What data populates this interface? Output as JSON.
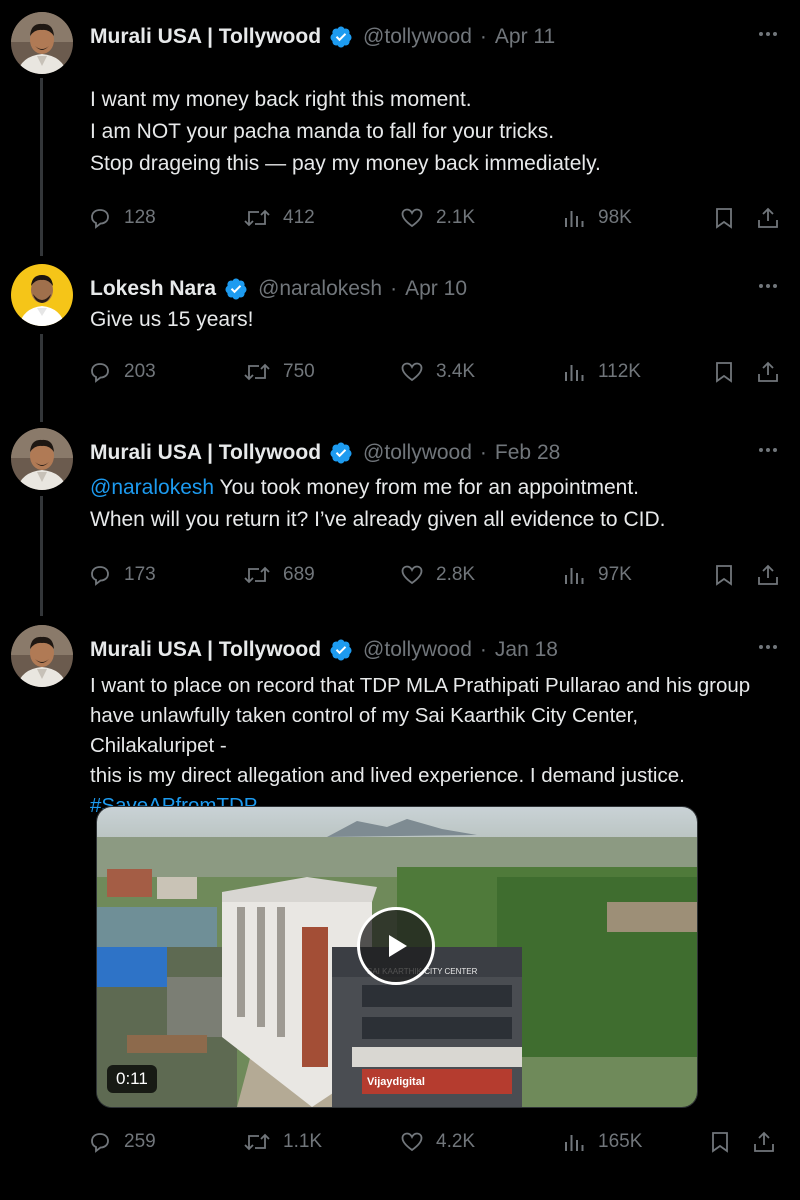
{
  "colors": {
    "background": "#000000",
    "text": "#e7e9ea",
    "muted": "#71767b",
    "link": "#1d9bf0",
    "verified": "#1d9bf0",
    "thread_line": "#333639"
  },
  "tweets": [
    {
      "name": "Murali USA | Tollywood",
      "handle": "@tollywood",
      "date": "Apr 11",
      "lines": [
        "I want my money back right this moment.",
        "I am NOT your pacha manda to fall for your tricks.",
        "Stop drageing this — pay my money back immediately."
      ],
      "replies": "128",
      "retweets": "412",
      "likes": "2.1K",
      "views": "98K"
    },
    {
      "name": "Lokesh Nara",
      "handle": "@naralokesh",
      "date": "Apr 10",
      "lines": [
        "Give us 15 years!"
      ],
      "replies": "203",
      "retweets": "750",
      "likes": "3.4K",
      "views": "112K"
    },
    {
      "name": "Murali USA | Tollywood",
      "handle": "@tollywood",
      "date": "Feb 28",
      "mention": "@naralokesh",
      "lines": [
        "You took money from me for an appointment.",
        "When will you return it? I’ve already given all evidence to CID."
      ],
      "replies": "173",
      "retweets": "689",
      "likes": "2.8K",
      "views": "97K"
    },
    {
      "name": "Murali USA | Tollywood",
      "handle": "@tollywood",
      "date": "Jan 18",
      "lines": [
        "I want to place on record that TDP MLA Prathipati Pullarao and his group",
        "have unlawfully taken control of my Sai Kaarthik City Center, Chilakaluripet -",
        "this is my direct allegation and lived experience. I demand justice."
      ],
      "hashtag": "#SaveAPfromTDP",
      "video": {
        "duration": "0:11",
        "building_sign": "SAI KAARTHIK CITY CENTER",
        "shop_sign": "Vijaydigital"
      },
      "replies": "259",
      "retweets": "1.1K",
      "likes": "4.2K",
      "views": "165K"
    }
  ]
}
